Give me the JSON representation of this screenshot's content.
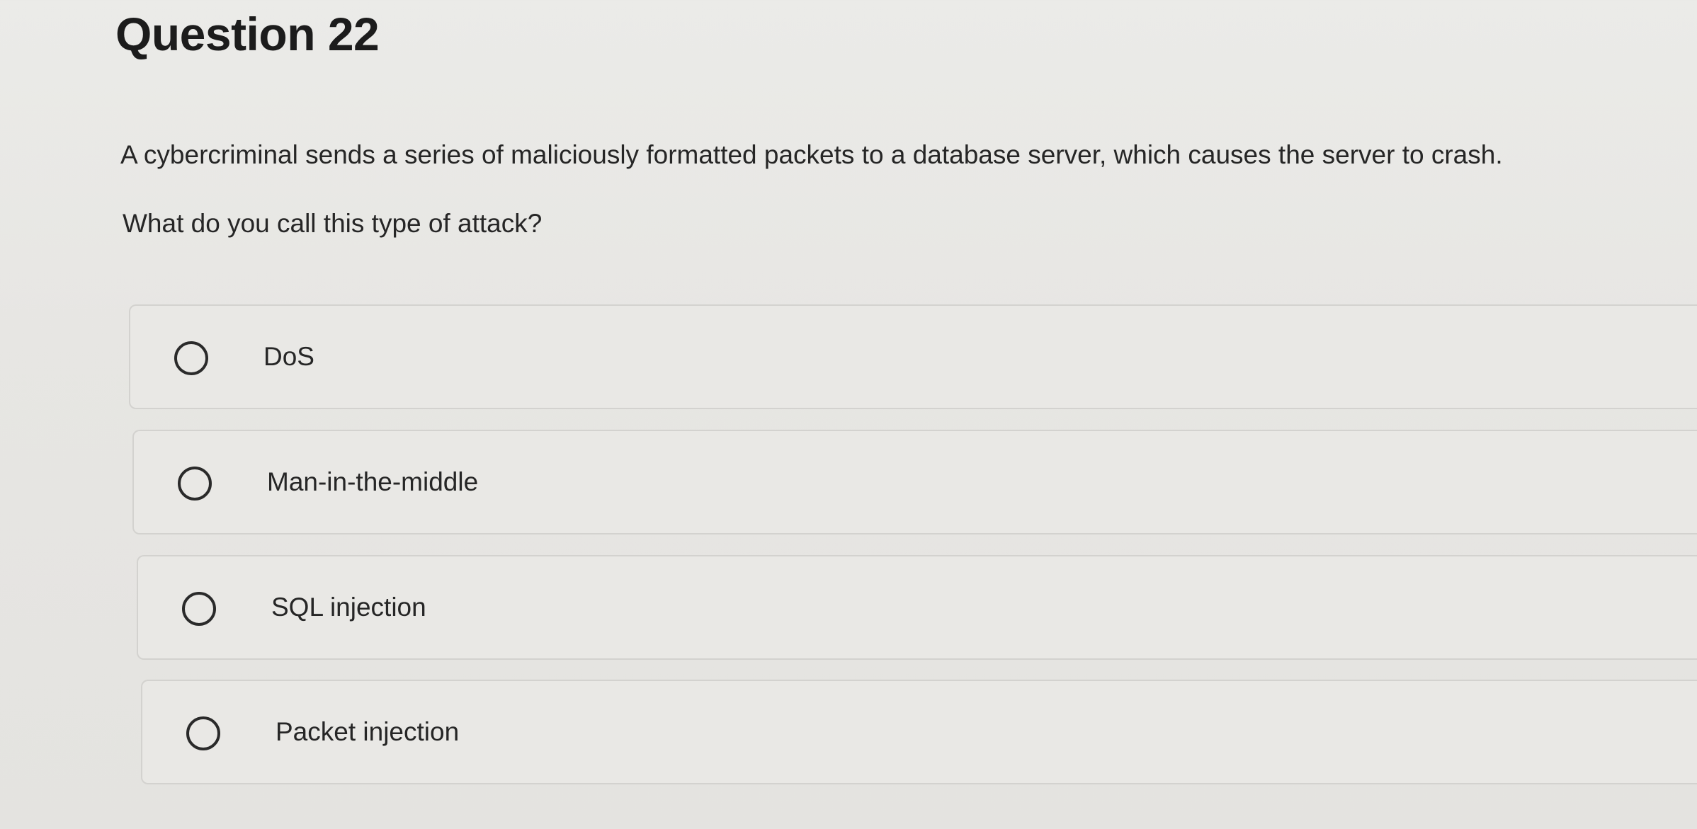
{
  "question": {
    "title": "Question 22",
    "text": "A cybercriminal sends a series of maliciously formatted packets to a database server, which causes the server to crash.",
    "prompt": "What do you call this type of attack?"
  },
  "options": [
    {
      "label": "DoS",
      "selected": false
    },
    {
      "label": "Man-in-the-middle",
      "selected": false
    },
    {
      "label": "SQL injection",
      "selected": false
    },
    {
      "label": "Packet injection",
      "selected": false
    }
  ],
  "colors": {
    "background": "#e8e7e4",
    "text": "#262626",
    "border": "#d3d2cf"
  }
}
